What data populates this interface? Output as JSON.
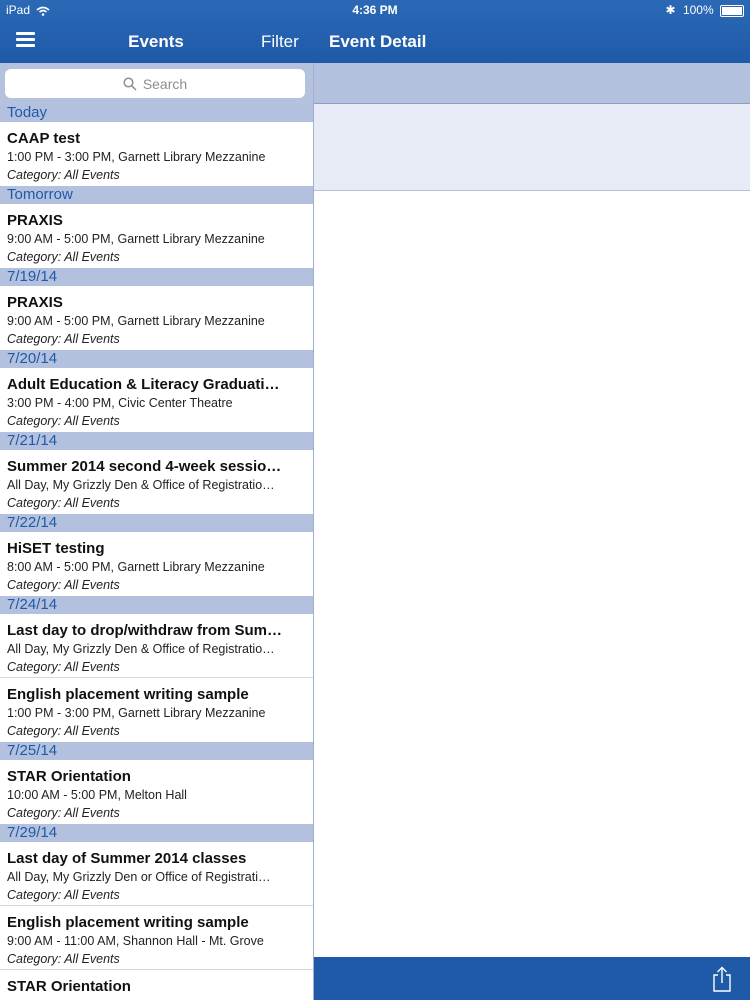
{
  "status_bar": {
    "device": "iPad",
    "time": "4:36 PM",
    "battery": "100%"
  },
  "nav": {
    "title": "Events",
    "filter_label": "Filter",
    "detail_title": "Event Detail"
  },
  "search": {
    "placeholder": "Search"
  },
  "icons": [
    "menu-icon",
    "search-icon",
    "wifi-icon",
    "bluetooth-icon",
    "battery-icon",
    "share-icon"
  ],
  "colors": {
    "nav_bar": "#1f5aa8",
    "section_header": "#b3c1de",
    "section_text": "#1f5aa8",
    "detail_band": "#e6ebf5"
  },
  "sections": [
    {
      "header": "Today",
      "events": [
        {
          "title": "CAAP test",
          "time": "1:00 PM - 3:00 PM, Garnett Library Mezzanine",
          "category": "Category: All Events"
        }
      ]
    },
    {
      "header": "Tomorrow",
      "events": [
        {
          "title": "PRAXIS",
          "time": "9:00 AM - 5:00 PM, Garnett Library Mezzanine",
          "category": "Category: All Events"
        }
      ]
    },
    {
      "header": "7/19/14",
      "events": [
        {
          "title": "PRAXIS",
          "time": "9:00 AM - 5:00 PM, Garnett Library Mezzanine",
          "category": "Category: All Events"
        }
      ]
    },
    {
      "header": "7/20/14",
      "events": [
        {
          "title": "Adult Education & Literacy Graduati…",
          "time": "3:00 PM - 4:00 PM, Civic Center Theatre",
          "category": "Category: All Events"
        }
      ]
    },
    {
      "header": "7/21/14",
      "events": [
        {
          "title": "Summer 2014 second 4-week sessio…",
          "time": "All Day, My Grizzly Den & Office of Registratio…",
          "category": "Category: All Events"
        }
      ]
    },
    {
      "header": "7/22/14",
      "events": [
        {
          "title": "HiSET testing",
          "time": "8:00 AM - 5:00 PM, Garnett Library Mezzanine",
          "category": "Category: All Events"
        }
      ]
    },
    {
      "header": "7/24/14",
      "events": [
        {
          "title": "Last day to drop/withdraw from Sum…",
          "time": "All Day, My Grizzly Den & Office of Registratio…",
          "category": "Category: All Events"
        },
        {
          "title": "English placement writing sample",
          "time": "1:00 PM - 3:00 PM, Garnett Library Mezzanine",
          "category": "Category: All Events"
        }
      ]
    },
    {
      "header": "7/25/14",
      "events": [
        {
          "title": "STAR Orientation",
          "time": "10:00 AM - 5:00 PM, Melton Hall",
          "category": "Category: All Events"
        }
      ]
    },
    {
      "header": "7/29/14",
      "events": [
        {
          "title": "Last day of Summer 2014 classes",
          "time": "All Day, My Grizzly Den or Office of Registrati…",
          "category": "Category: All Events"
        },
        {
          "title": "English placement writing sample",
          "time": "9:00 AM - 11:00 AM, Shannon Hall - Mt. Grove",
          "category": "Category: All Events"
        },
        {
          "title": "STAR Orientation",
          "time": "",
          "category": ""
        }
      ]
    }
  ]
}
